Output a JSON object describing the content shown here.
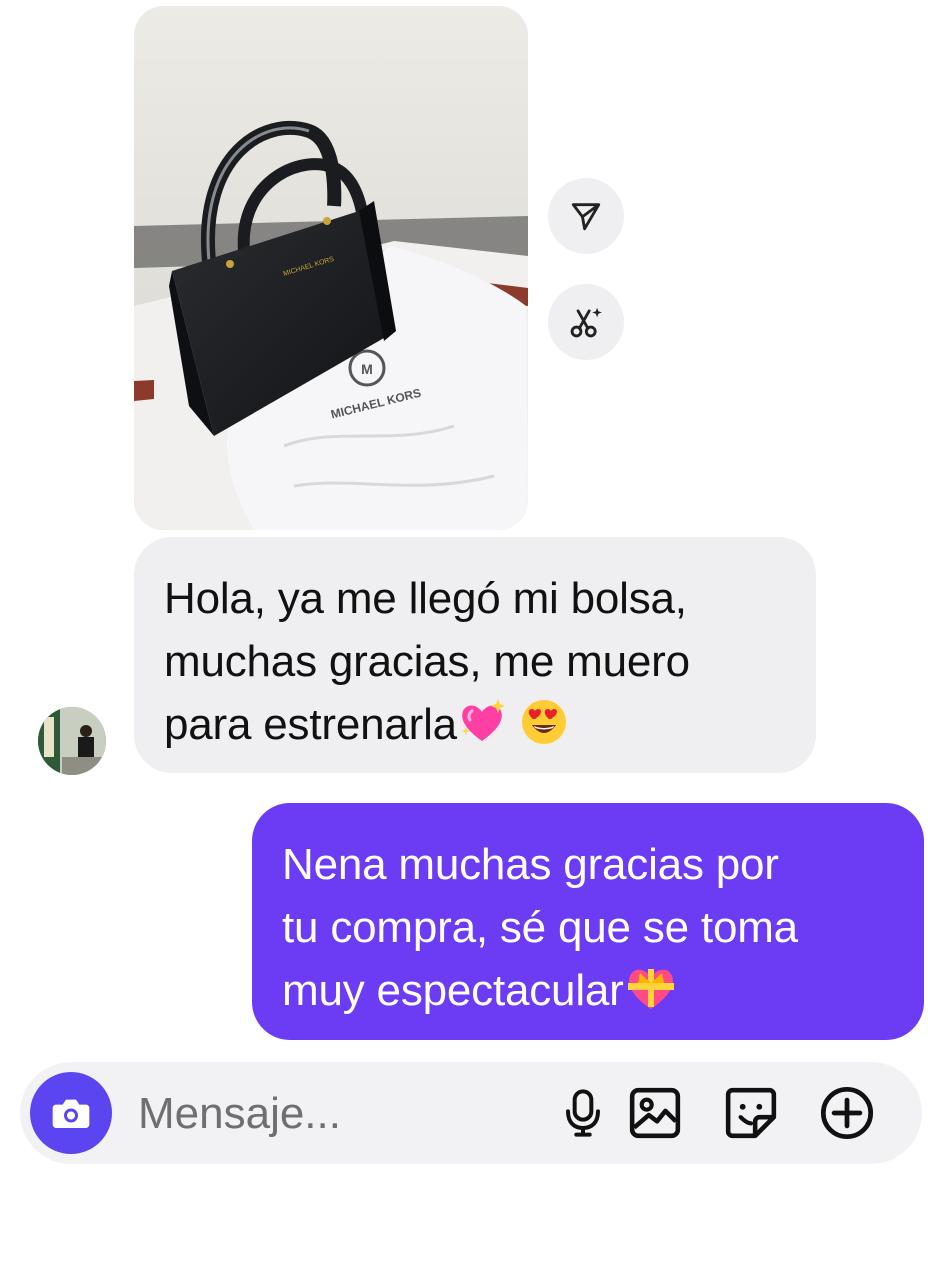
{
  "photo_message": {
    "bag_brand_text": "MICHAEL KORS",
    "dustbag_brand_text": "MICHAEL KORS"
  },
  "side_actions": {
    "share_icon": "paper-plane-icon",
    "edit_icon": "scissors-sparkle-icon"
  },
  "incoming": {
    "lines": [
      "Hola, ya me llegó mi bolsa,",
      "muchas gracias, me muero",
      "para estrenarla"
    ],
    "emojis": [
      "sparkling-heart-emoji",
      "heart-eyes-emoji"
    ]
  },
  "outgoing": {
    "lines": [
      "Nena muchas gracias por",
      "tu compra, sé que se toma",
      "muy espectacular"
    ],
    "emoji": "heart-with-ribbon-emoji",
    "bubble_color": "#6c3cf4"
  },
  "composer": {
    "placeholder": "Mensaje...",
    "camera_color": "#5a45f0",
    "icons": [
      "camera-icon",
      "microphone-icon",
      "gallery-icon",
      "sticker-icon",
      "plus-circle-icon"
    ]
  }
}
